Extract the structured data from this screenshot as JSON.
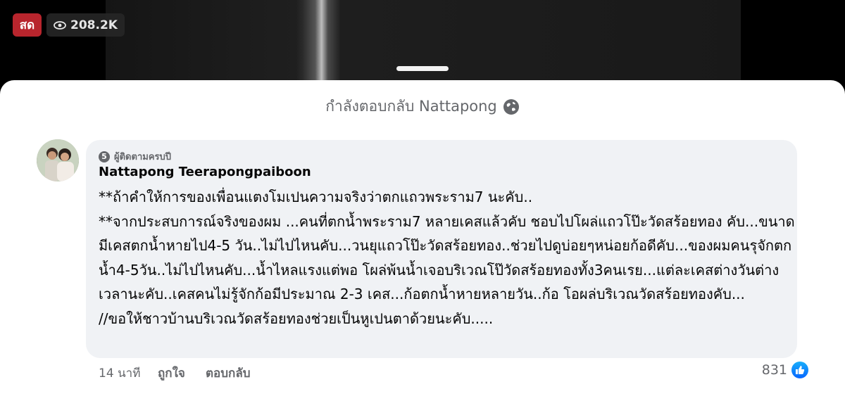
{
  "live": {
    "badge_label": "สด",
    "viewer_count": "208.2K",
    "viewer_icon": "eye-icon"
  },
  "reply_header": {
    "text": "กำลังตอบกลับ Nattapong",
    "icon": "globe-icon"
  },
  "comment": {
    "badge_text": "ผู้ติดตามครบปี",
    "badge_number": "5",
    "author": "Nattapong Teerapongpaiboon",
    "lines": [
      "**ถ้าคำให้การของเพื่อนแตงโมเปนความจริงว่าตกแถวพระราม7 นะคับ..",
      "**จากประสบการณ์จริงของผม ...คนที่ตกน้ำพระราม7 หลายเคสแล้วคับ ชอบไปโผล่แถวโป๊ะวัดสร้อยทอง คับ...ขนาดมีเคสตกน้ำหายไป4-5 วัน..ไม่ไปไหนคับ...วนยุแถวโป๊ะวัดสร้อยทอง..ช่วยไปดูบ่อยๆหน่อยก้อดีคับ...ของผมคนรุจักตกน้ำ4-5วัน..ไม่ไปไหนคับ...น้ำไหลแรงแต่พอ โผล่พ้นน้ำเจอบริเวณโป๊วัดสร้อยทองทั้ง3คนเรย...แต่ละเคสต่างวันต่างเวลานะคับ..เคสคนไม่รู้จักก้อมีประมาณ 2-3 เคส...ก้อตกน้ำหายหลายวัน..ก้อ โอผล่บริเวณวัดสร้อยทองคับ...",
      "//ขอให้ชาวบ้านบริเวณวัดสร้อยทองช่วยเป็นหูเปนตาด้วยนะคับ....."
    ],
    "time": "14 นาที",
    "like_label": "ถูกใจ",
    "reply_label": "ตอบกลับ",
    "reaction_count": "831",
    "reaction_icon": "like-thumb-icon"
  },
  "colors": {
    "live_red": "#b8252d",
    "like_blue": "#0866ff",
    "bubble_bg": "#f0f2f5"
  }
}
